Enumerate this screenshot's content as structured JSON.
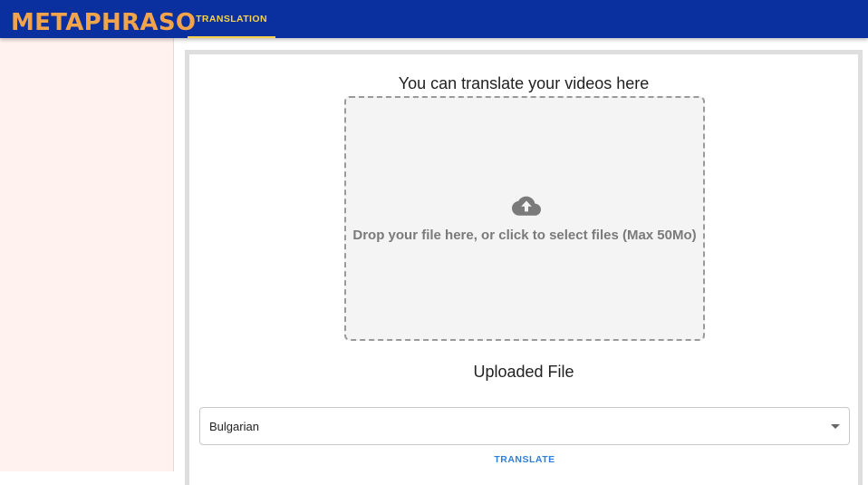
{
  "header": {
    "brand": "METAPHRASO",
    "tabs": [
      {
        "label": "TRANSLATION",
        "active": true
      }
    ]
  },
  "main": {
    "heading": "You can translate your videos here",
    "dropzone": {
      "icon": "cloud-upload-icon",
      "text": "Drop your file here, or click to select files (Max 50Mo)"
    },
    "uploaded_title": "Uploaded File",
    "language_select": {
      "value": "Bulgarian",
      "icon": "caret-down-icon"
    },
    "translate_button": "TRANSLATE"
  },
  "colors": {
    "header_bg": "#0a2f9f",
    "brand": "#f2a44c",
    "tab_active": "#f5d24a",
    "sidebar_bg": "#fff2ef",
    "dropzone_bg": "#f4f4f4",
    "button_text": "#2f7fd8"
  }
}
